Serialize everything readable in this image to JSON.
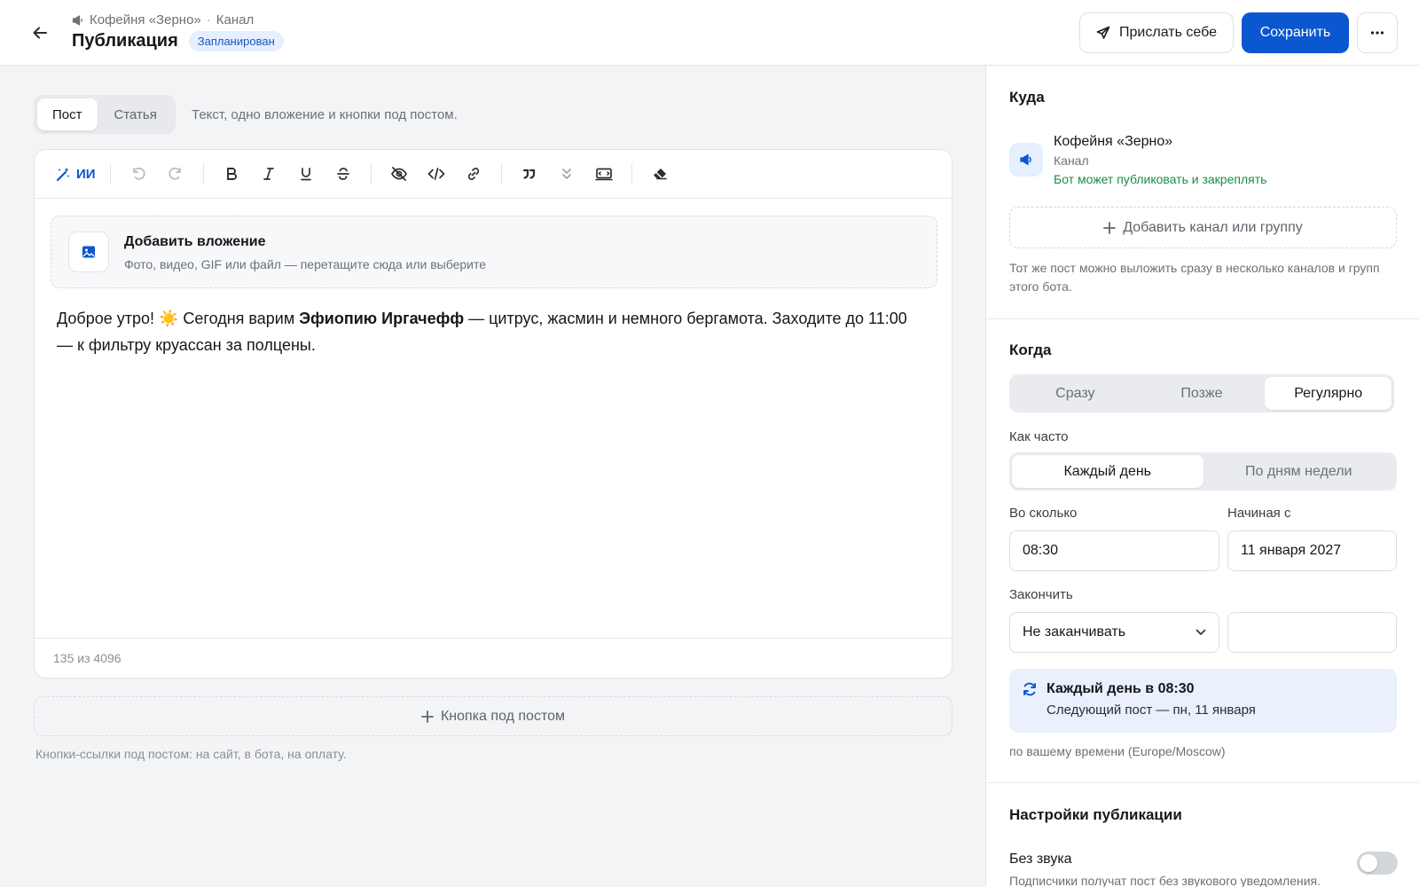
{
  "header": {
    "breadcrumb_channel": "Кофейня «Зерно»",
    "breadcrumb_sep": "·",
    "breadcrumb_type": "Канал",
    "title": "Публикация",
    "status": "Запланирован",
    "send_self_label": "Прислать себе",
    "save_label": "Сохранить",
    "more_icon": "ellipsis-icon"
  },
  "editor": {
    "tabs": [
      {
        "label": "Пост",
        "active": true
      },
      {
        "label": "Статья",
        "active": false
      }
    ],
    "tabs_hint": "Текст, одно вложение и кнопки под постом.",
    "toolbar": {
      "ai_label": "ИИ",
      "icons": [
        "undo-icon",
        "redo-icon",
        "bold-icon",
        "italic-icon",
        "underline-icon",
        "strikethrough-icon",
        "spoiler-icon",
        "code-icon",
        "link-icon",
        "quote-icon",
        "expandable-quote-icon",
        "monospace-block-icon",
        "clear-format-icon"
      ]
    },
    "attachment": {
      "title": "Добавить вложение",
      "subtitle": "Фото, видео, GIF или файл — перетащите сюда или выберите"
    },
    "text": {
      "part1": "Доброе утро! ☀️ Сегодня варим ",
      "bold": "Эфиопию Иргачефф",
      "part2": " — цитрус, жасмин и немного бергамота. Заходите до 11:00 — к фильтру круассан за полцены."
    },
    "counter": "135 из 4096",
    "add_button_label": "Кнопка под постом",
    "add_button_hint": "Кнопки-ссылки под постом: на сайт, в бота, на оплату."
  },
  "panel": {
    "where": {
      "title": "Куда",
      "channel_name": "Кофейня «Зерно»",
      "channel_type": "Канал",
      "channel_permission": "Бот может публиковать и закреплять",
      "add_label": "Добавить канал или группу",
      "hint": "Тот же пост можно выложить сразу в несколько каналов и групп этого бота."
    },
    "when": {
      "title": "Когда",
      "modes": [
        {
          "label": "Сразу",
          "active": false
        },
        {
          "label": "Позже",
          "active": false
        },
        {
          "label": "Регулярно",
          "active": true
        }
      ],
      "frequency_label": "Как часто",
      "frequency": [
        {
          "label": "Каждый день",
          "active": true
        },
        {
          "label": "По дням недели",
          "active": false
        }
      ],
      "time_label": "Во сколько",
      "time_value": "08:30",
      "start_label": "Начиная с",
      "start_value": "11 января 2027",
      "end_label": "Закончить",
      "end_value": "Не заканчивать",
      "end_extra_value": "",
      "summary_title": "Каждый день в 08:30",
      "summary_sub": "Следующий пост — пн, 11 января",
      "tz_hint": "по вашему времени (Europe/Moscow)"
    },
    "settings": {
      "title": "Настройки публикации",
      "silent_label": "Без звука",
      "silent_sub": "Подписчики получат пост без звукового уведомления.",
      "silent_on": false
    }
  },
  "colors": {
    "accent": "#0b57d0",
    "success": "#1e8a4c",
    "badge_bg": "#e6efff"
  }
}
